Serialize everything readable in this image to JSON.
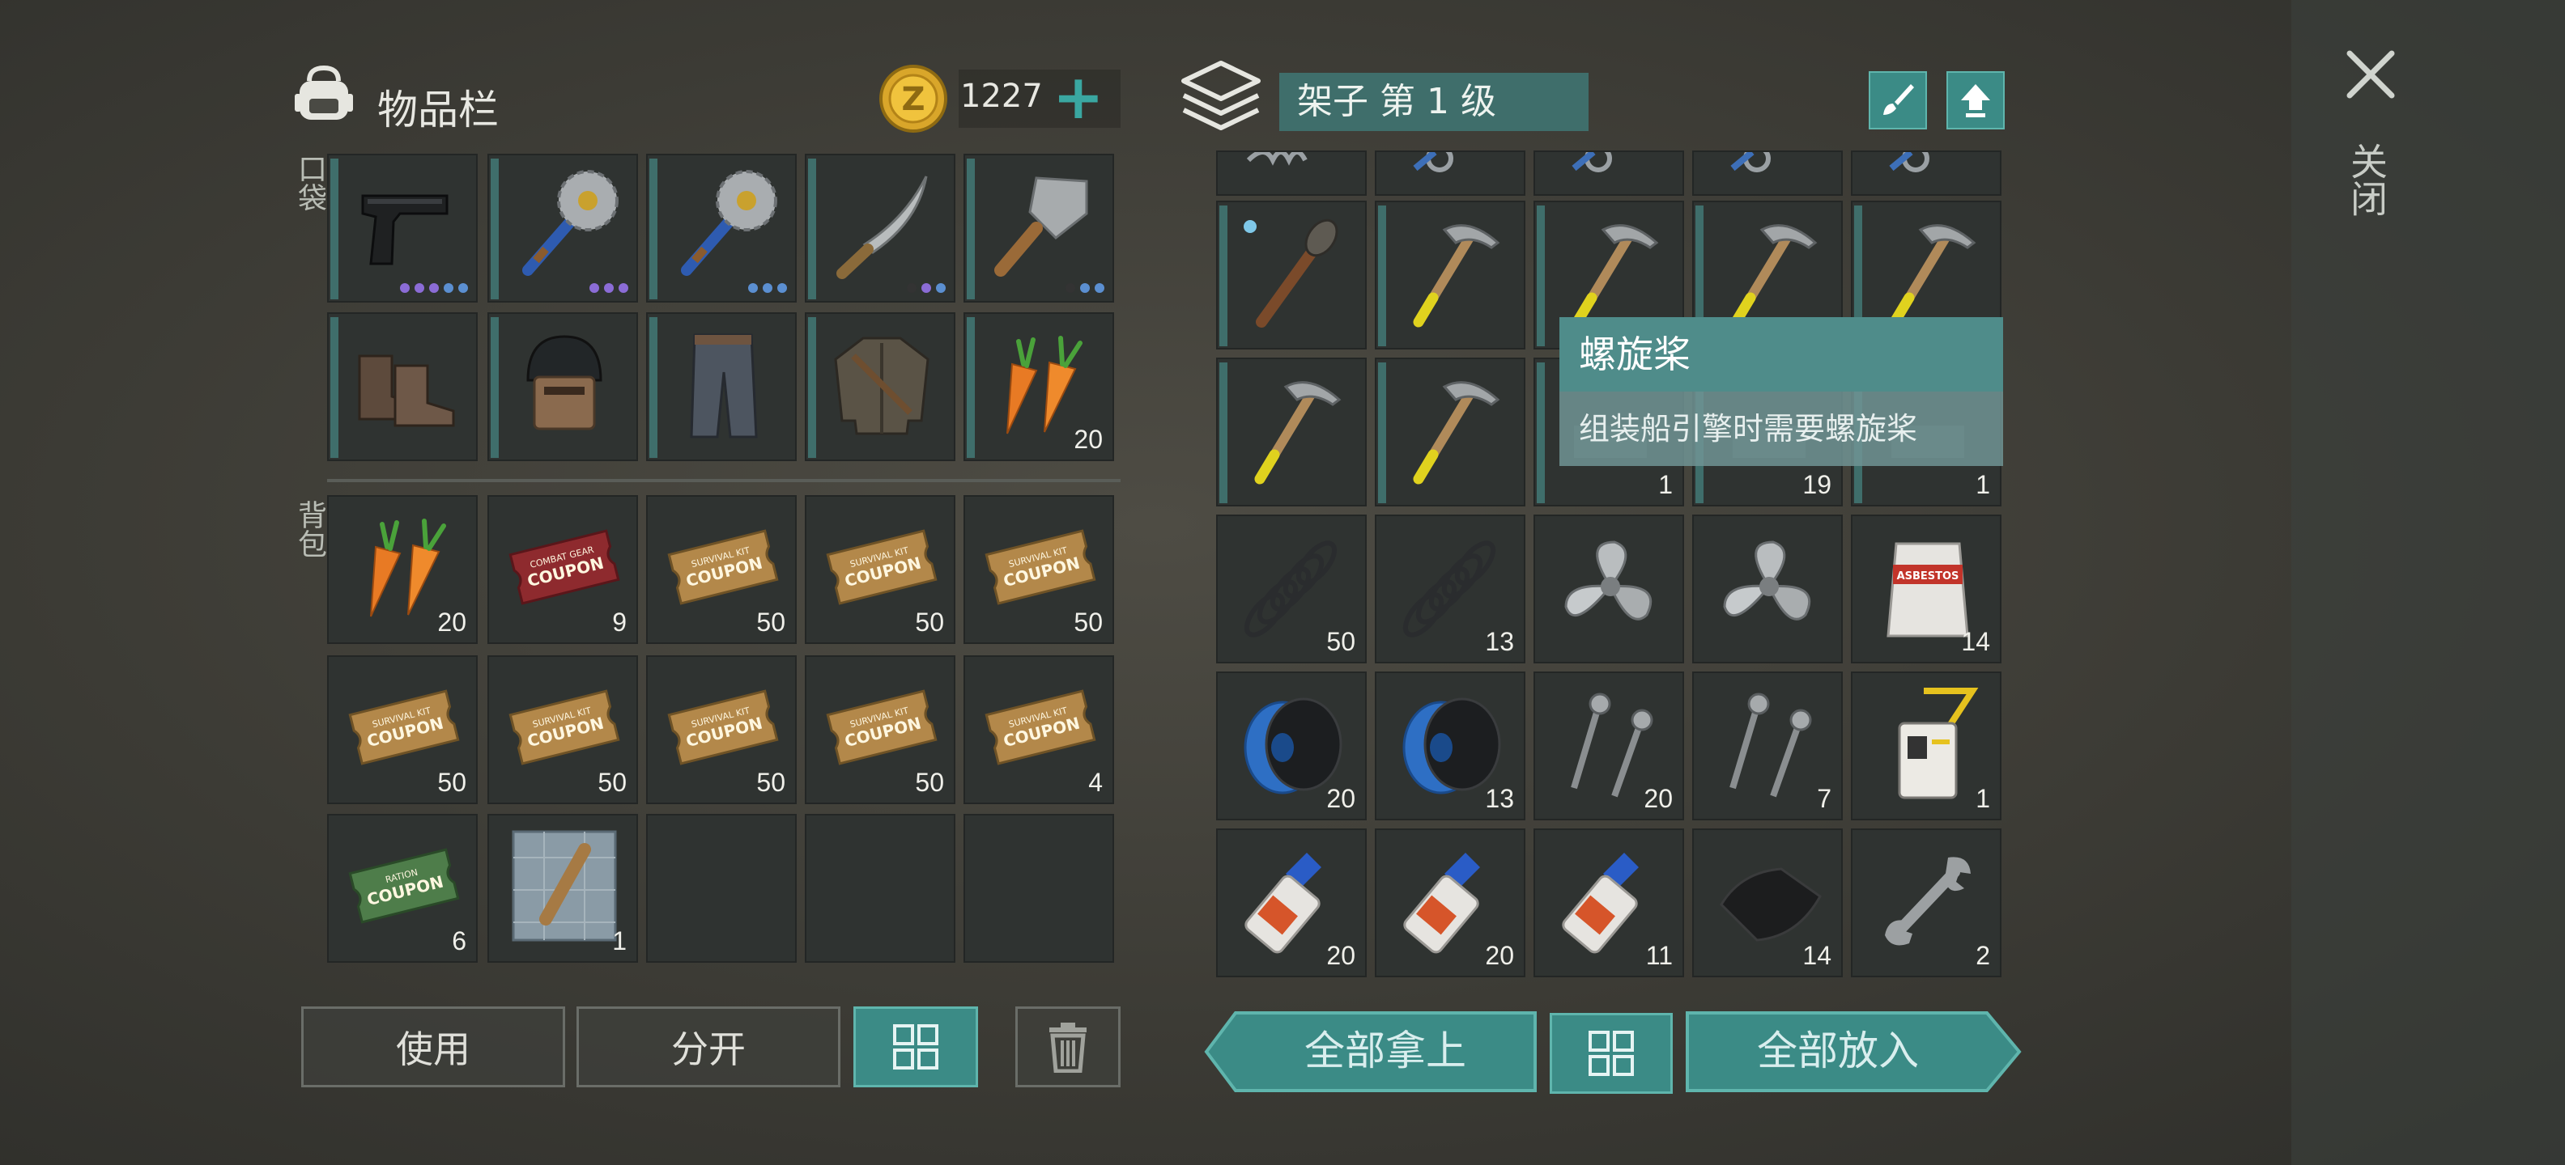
{
  "inventory": {
    "title": "物品栏",
    "coins": "1227",
    "pocket_label": "口袋",
    "backpack_label": "背包",
    "pocket_row1": [
      {
        "name": "pistol",
        "dots": [
          "#8b6cd6",
          "#8b6cd6",
          "#8b6cd6",
          "#5b8fd1",
          "#5b8fd1"
        ]
      },
      {
        "name": "saw-mace",
        "dots": [
          "#8b6cd6",
          "#8b6cd6",
          "#8b6cd6"
        ]
      },
      {
        "name": "saw-mace",
        "dots": [
          "#5b8fd1",
          "#5b8fd1",
          "#5b8fd1"
        ]
      },
      {
        "name": "machete",
        "dots": [
          "#333333",
          "#8b6cd6",
          "#5b8fd1"
        ]
      },
      {
        "name": "cleaver",
        "dots": [
          "#333333",
          "#5b8fd1",
          "#5b8fd1"
        ]
      }
    ],
    "pocket_row2": [
      {
        "name": "boots",
        "count": ""
      },
      {
        "name": "helmet",
        "count": ""
      },
      {
        "name": "pants",
        "count": ""
      },
      {
        "name": "jacket",
        "count": ""
      },
      {
        "name": "carrots",
        "count": "20"
      }
    ],
    "backpack": [
      {
        "name": "carrots",
        "count": "20"
      },
      {
        "name": "combat-coupon",
        "count": "9"
      },
      {
        "name": "survival-coupon",
        "count": "50"
      },
      {
        "name": "survival-coupon",
        "count": "50"
      },
      {
        "name": "survival-coupon",
        "count": "50"
      },
      {
        "name": "survival-coupon",
        "count": "50"
      },
      {
        "name": "survival-coupon",
        "count": "50"
      },
      {
        "name": "survival-coupon",
        "count": "50"
      },
      {
        "name": "survival-coupon",
        "count": "50"
      },
      {
        "name": "survival-coupon",
        "count": "4"
      },
      {
        "name": "ration-coupon",
        "count": "6"
      },
      {
        "name": "blueprint",
        "count": "1"
      },
      {
        "name": "empty",
        "count": ""
      },
      {
        "name": "empty",
        "count": ""
      },
      {
        "name": "empty",
        "count": ""
      }
    ],
    "buttons": {
      "use": "使用",
      "split": "分开"
    }
  },
  "shelf": {
    "title": "架子 第 1 级",
    "rows": [
      [
        {
          "name": "spring-top",
          "count": ""
        },
        {
          "name": "tool-top",
          "count": ""
        },
        {
          "name": "tool-top",
          "count": ""
        },
        {
          "name": "tool-top",
          "count": ""
        },
        {
          "name": "tool-top",
          "count": ""
        }
      ],
      [
        {
          "name": "torch",
          "count": ""
        },
        {
          "name": "hammer",
          "count": ""
        },
        {
          "name": "hammer",
          "count": ""
        },
        {
          "name": "hammer",
          "count": ""
        },
        {
          "name": "hammer",
          "count": ""
        }
      ],
      [
        {
          "name": "hammer",
          "count": ""
        },
        {
          "name": "hammer",
          "count": ""
        },
        {
          "name": "item",
          "count": "1"
        },
        {
          "name": "item",
          "count": "19"
        },
        {
          "name": "item",
          "count": "1"
        }
      ],
      [
        {
          "name": "spring",
          "count": "50"
        },
        {
          "name": "spring",
          "count": "13"
        },
        {
          "name": "propeller",
          "count": ""
        },
        {
          "name": "propeller",
          "count": ""
        },
        {
          "name": "asbestos",
          "count": "14"
        }
      ],
      [
        {
          "name": "wire-spool",
          "count": "20"
        },
        {
          "name": "wire-spool",
          "count": "13"
        },
        {
          "name": "screws",
          "count": "20"
        },
        {
          "name": "screws",
          "count": "7"
        },
        {
          "name": "id-badge",
          "count": "1"
        }
      ],
      [
        {
          "name": "glue",
          "count": "20"
        },
        {
          "name": "glue",
          "count": "20"
        },
        {
          "name": "glue",
          "count": "11"
        },
        {
          "name": "cloth",
          "count": "14"
        },
        {
          "name": "wrench",
          "count": "2"
        }
      ]
    ],
    "asbestos_label": "ASBESTOS",
    "buttons": {
      "take_all": "全部拿上",
      "put_all": "全部放入"
    }
  },
  "tooltip": {
    "title": "螺旋桨",
    "description": "组装船引擎时需要螺旋桨"
  },
  "close_label": "关闭",
  "coupons": {
    "coupon": "COUPON",
    "combat": "COMBAT GEAR",
    "survival": "SURVIVAL KIT",
    "ration": "RATION"
  }
}
